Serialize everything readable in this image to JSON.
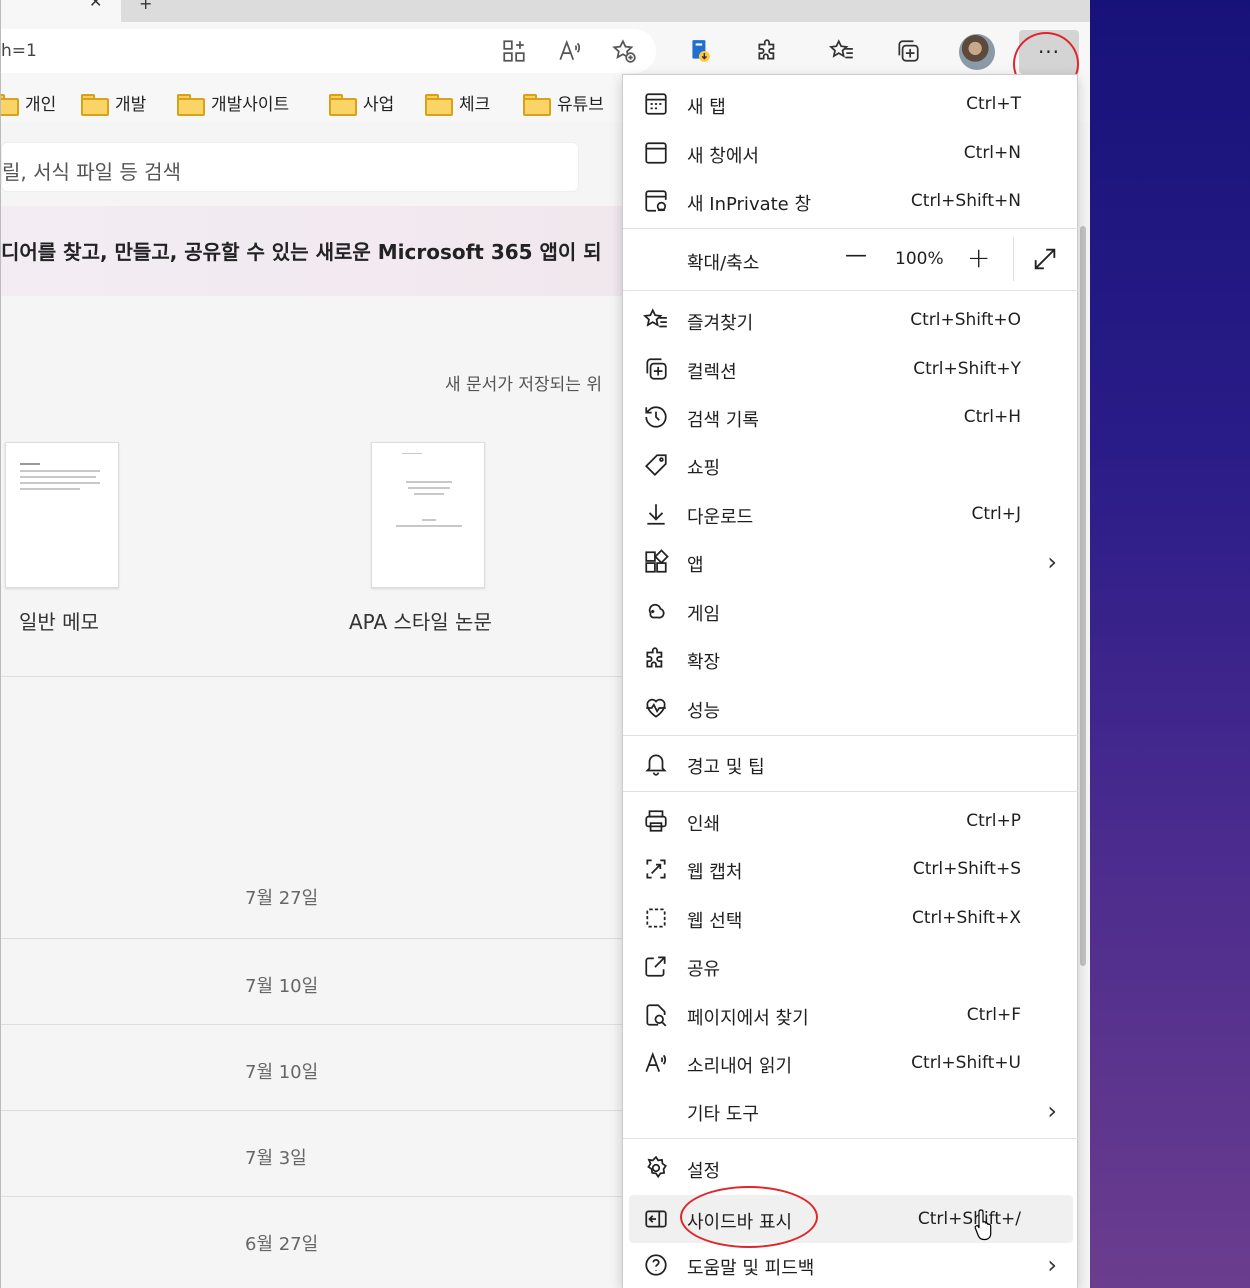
{
  "browser": {
    "address_text": "h=1",
    "bookmarks": [
      "개인",
      "개발",
      "개발사이트",
      "사업",
      "체크",
      "유튜브"
    ]
  },
  "page": {
    "search_placeholder": "릴, 서식 파일 등 검색",
    "promo_text": "디어를 찾고, 만들고, 공유할 수 있는 새로운 Microsoft 365 앱이 되",
    "save_location_text": "새 문서가 저장되는 위",
    "templates": [
      {
        "label": "일반 메모"
      },
      {
        "label": "APA 스타일 논문"
      }
    ],
    "recent_dates": [
      "7월 27일",
      "7월 10일",
      "7월 10일",
      "7월 3일",
      "6월 27일"
    ]
  },
  "menu": {
    "items": [
      {
        "label": "새 탭",
        "shortcut": "Ctrl+T",
        "icon": "new-tab-icon"
      },
      {
        "label": "새 창에서",
        "shortcut": "Ctrl+N",
        "icon": "new-window-icon"
      },
      {
        "label": "새 InPrivate 창",
        "shortcut": "Ctrl+Shift+N",
        "icon": "inprivate-icon"
      }
    ],
    "zoom": {
      "label": "확대/축소",
      "minus": "—",
      "value": "100%",
      "plus": "+"
    },
    "items2": [
      {
        "label": "즐겨찾기",
        "shortcut": "Ctrl+Shift+O",
        "icon": "favorites-icon"
      },
      {
        "label": "컬렉션",
        "shortcut": "Ctrl+Shift+Y",
        "icon": "collections-icon"
      },
      {
        "label": "검색 기록",
        "shortcut": "Ctrl+H",
        "icon": "history-icon"
      },
      {
        "label": "쇼핑",
        "shortcut": "",
        "icon": "shopping-tag-icon"
      },
      {
        "label": "다운로드",
        "shortcut": "Ctrl+J",
        "icon": "download-icon"
      },
      {
        "label": "앱",
        "shortcut": "",
        "icon": "apps-icon"
      },
      {
        "label": "게임",
        "shortcut": "",
        "icon": "games-icon"
      },
      {
        "label": "확장",
        "shortcut": "",
        "icon": "extensions-icon"
      },
      {
        "label": "성능",
        "shortcut": "",
        "icon": "performance-icon"
      }
    ],
    "items3": [
      {
        "label": "경고 및 팁",
        "shortcut": "",
        "icon": "bell-icon"
      }
    ],
    "items4": [
      {
        "label": "인쇄",
        "shortcut": "Ctrl+P",
        "icon": "print-icon"
      },
      {
        "label": "웹 캡처",
        "shortcut": "Ctrl+Shift+S",
        "icon": "web-capture-icon"
      },
      {
        "label": "웹 선택",
        "shortcut": "Ctrl+Shift+X",
        "icon": "web-select-icon"
      },
      {
        "label": "공유",
        "shortcut": "",
        "icon": "share-icon"
      },
      {
        "label": "페이지에서 찾기",
        "shortcut": "Ctrl+F",
        "icon": "find-in-page-icon"
      },
      {
        "label": "소리내어 읽기",
        "shortcut": "Ctrl+Shift+U",
        "icon": "read-aloud-icon"
      },
      {
        "label": "기타 도구",
        "shortcut": "",
        "icon": ""
      }
    ],
    "items5": [
      {
        "label": "설정",
        "shortcut": "",
        "icon": "settings-icon"
      },
      {
        "label": "사이드바 표시",
        "shortcut": "Ctrl+Shift+/",
        "icon": "sidebar-icon"
      },
      {
        "label": "도움말 및 피드백",
        "shortcut": "",
        "icon": "help-icon"
      }
    ]
  },
  "colors": {
    "highlight": "#e0262d",
    "desktop": "#2a1c88"
  }
}
